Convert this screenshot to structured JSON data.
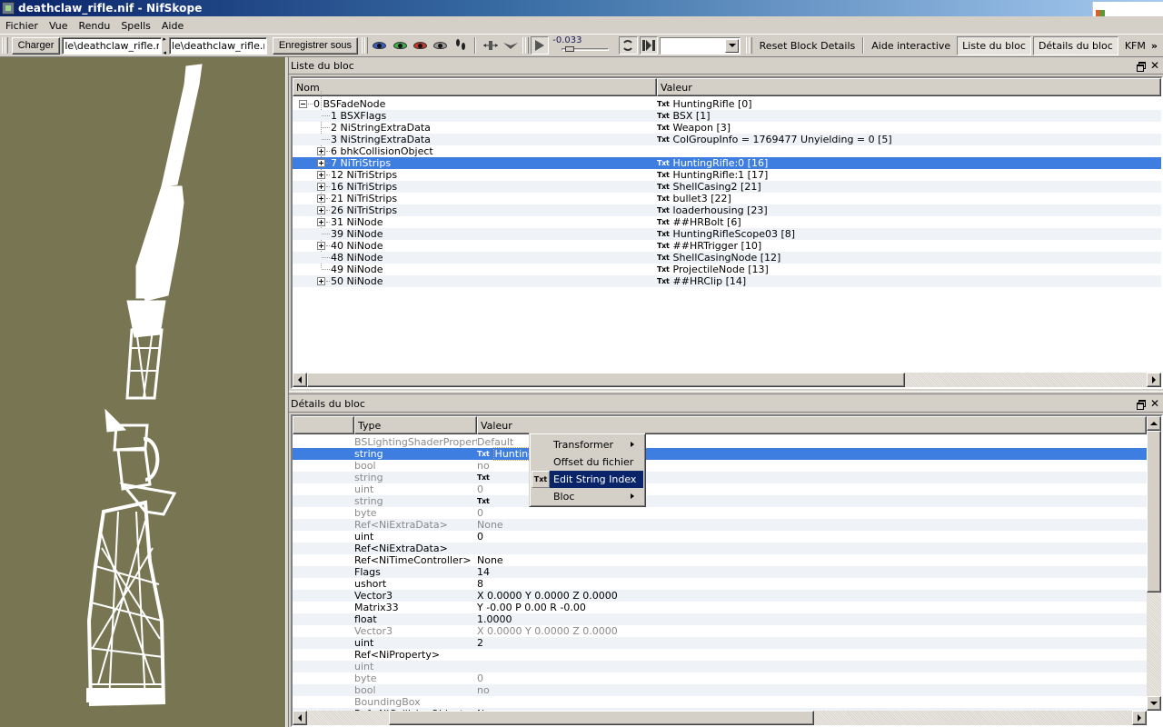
{
  "window": {
    "title": "deathclaw_rifle.nif - NifSkope"
  },
  "menubar": [
    "Fichier",
    "Vue",
    "Rendu",
    "Spells",
    "Aide"
  ],
  "toolbar": {
    "load_label": "Charger",
    "load_path": "le\\deathclaw_rifle.nif",
    "save_path": "le\\deathclaw_rifle.nif",
    "save_as_label": "Enregistrer sous",
    "view_icons": [
      "eye-blue-icon",
      "eye-green-icon",
      "eye-red-icon",
      "eye-gray-icon",
      "footprints-icon",
      "axes-icon",
      "plane-icon"
    ],
    "time_value": "-0.033",
    "time_slider_fraction": 0.1,
    "animation_select_value": "",
    "reset_block_details": "Reset Block Details",
    "interactive_help": "Aide interactive",
    "block_list_toggle": "Liste du bloc",
    "block_details_toggle": "Détails du bloc",
    "kfm": "KFM",
    "overflow": "»"
  },
  "block_list": {
    "title": "Liste du bloc",
    "columns": [
      "Nom",
      "Valeur"
    ],
    "rows": [
      {
        "level": 0,
        "expander": "minus",
        "name": "0 BSFadeNode",
        "txt": true,
        "value": "HuntingRifle [0]"
      },
      {
        "level": 1,
        "expander": "none",
        "name": "1 BSXFlags",
        "txt": true,
        "value": "BSX [1]"
      },
      {
        "level": 1,
        "expander": "none",
        "name": "2 NiStringExtraData",
        "txt": true,
        "value": "Weapon [3]"
      },
      {
        "level": 1,
        "expander": "none",
        "name": "3 NiStringExtraData",
        "txt": true,
        "value": "ColGroupInfo = 1769477 Unyielding = 0  [5]"
      },
      {
        "level": 1,
        "expander": "plus",
        "name": "6 bhkCollisionObject",
        "txt": false,
        "value": ""
      },
      {
        "level": 1,
        "expander": "plus",
        "name": "7 NiTriStrips",
        "txt": true,
        "value": "HuntingRifle:0 [16]",
        "selected": true
      },
      {
        "level": 1,
        "expander": "plus",
        "name": "12 NiTriStrips",
        "txt": true,
        "value": "HuntingRifle:1 [17]"
      },
      {
        "level": 1,
        "expander": "plus",
        "name": "16 NiTriStrips",
        "txt": true,
        "value": "ShellCasing2 [21]"
      },
      {
        "level": 1,
        "expander": "plus",
        "name": "21 NiTriStrips",
        "txt": true,
        "value": "bullet3 [22]"
      },
      {
        "level": 1,
        "expander": "plus",
        "name": "26 NiTriStrips",
        "txt": true,
        "value": "loaderhousing [23]"
      },
      {
        "level": 1,
        "expander": "plus",
        "name": "31 NiNode",
        "txt": true,
        "value": "##HRBolt [6]"
      },
      {
        "level": 1,
        "expander": "none",
        "name": "39 NiNode",
        "txt": true,
        "value": "HuntingRifleScope03 [8]"
      },
      {
        "level": 1,
        "expander": "plus",
        "name": "40 NiNode",
        "txt": true,
        "value": "##HRTrigger [10]"
      },
      {
        "level": 1,
        "expander": "none",
        "name": "48 NiNode",
        "txt": true,
        "value": "ShellCasingNode [12]"
      },
      {
        "level": 1,
        "expander": "none",
        "name": "49 NiNode",
        "txt": true,
        "value": "ProjectileNode [13]"
      },
      {
        "level": 1,
        "expander": "plus",
        "name": "50 NiNode",
        "txt": true,
        "value": "##HRClip [14]"
      }
    ],
    "txt_icon_label": "Txt"
  },
  "block_details": {
    "title": "Détails du bloc",
    "columns": [
      "",
      "Type",
      "Valeur"
    ],
    "rows": [
      {
        "type": "BSLightingShaderPropert...",
        "value": "Default",
        "dim": true
      },
      {
        "type": "string",
        "value": "HuntingR",
        "txt": true,
        "selected": true
      },
      {
        "type": "bool",
        "value": "no",
        "dim": true
      },
      {
        "type": "string",
        "value": "",
        "txt": true,
        "dim": true
      },
      {
        "type": "uint",
        "value": "0",
        "dim": true
      },
      {
        "type": "string",
        "value": "",
        "txt": true,
        "dim": true
      },
      {
        "type": "byte",
        "value": "0",
        "dim": true
      },
      {
        "type": "Ref<NiExtraData>",
        "value": "None",
        "dim": true
      },
      {
        "type": "uint",
        "value": "0"
      },
      {
        "type": "Ref<NiExtraData>",
        "value": ""
      },
      {
        "type": "Ref<NiTimeController>",
        "value": "None"
      },
      {
        "type": "Flags",
        "value": "14"
      },
      {
        "type": "ushort",
        "value": "8"
      },
      {
        "type": "Vector3",
        "value": "X 0.0000 Y 0.0000 Z 0.0000"
      },
      {
        "type": "Matrix33",
        "value": "Y -0.00 P 0.00 R -0.00"
      },
      {
        "type": "float",
        "value": "1.0000"
      },
      {
        "type": "Vector3",
        "value": "X 0.0000 Y 0.0000 Z 0.0000",
        "dim": true
      },
      {
        "type": "uint",
        "value": "2"
      },
      {
        "type": "Ref<NiProperty>",
        "value": ""
      },
      {
        "type": "uint",
        "value": "",
        "dim": true
      },
      {
        "type": "byte",
        "value": "0",
        "dim": true
      },
      {
        "type": "bool",
        "value": "no",
        "dim": true
      },
      {
        "type": "BoundingBox",
        "value": "",
        "dim": true
      },
      {
        "type": "Ref<NiCollisionObject>",
        "value": "None"
      }
    ]
  },
  "context_menu": {
    "items": [
      {
        "label": "Transformer",
        "submenu": true
      },
      {
        "label": "Offset du fichier",
        "submenu": false
      },
      {
        "label": "Edit String Index",
        "submenu": false,
        "icon": "Txt",
        "highlighted": true
      },
      {
        "label": "Bloc",
        "submenu": true
      }
    ]
  },
  "colors": {
    "viewport_bg": "#777552",
    "selection": "#3d7ee0",
    "menu_highlight": "#0a246a",
    "chrome": "#d4d0c8"
  }
}
